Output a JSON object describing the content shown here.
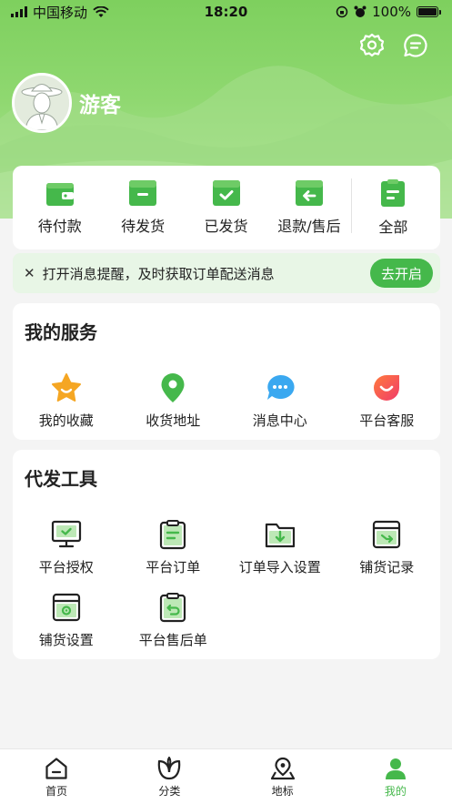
{
  "status_bar": {
    "carrier": "中国移动",
    "time": "18:20",
    "battery": "100%"
  },
  "header": {
    "settings_icon": "gear-icon",
    "message_icon": "chat-icon"
  },
  "profile": {
    "username": "游客"
  },
  "orders": [
    {
      "label": "待付款",
      "icon": "wallet-icon"
    },
    {
      "label": "待发货",
      "icon": "box-icon"
    },
    {
      "label": "已发货",
      "icon": "box-check-icon"
    },
    {
      "label": "退款/售后",
      "icon": "return-box-icon"
    },
    {
      "label": "全部",
      "icon": "clipboard-icon"
    }
  ],
  "notice": {
    "text": "打开消息提醒，及时获取订单配送消息",
    "button": "去开启"
  },
  "services": {
    "title": "我的服务",
    "items": [
      {
        "label": "我的收藏",
        "icon": "star-icon"
      },
      {
        "label": "收货地址",
        "icon": "location-pin-icon"
      },
      {
        "label": "消息中心",
        "icon": "message-bubble-icon"
      },
      {
        "label": "平台客服",
        "icon": "customer-service-icon"
      }
    ]
  },
  "tools": {
    "title": "代发工具",
    "items": [
      {
        "label": "平台授权",
        "icon": "monitor-check-icon"
      },
      {
        "label": "平台订单",
        "icon": "clipboard-list-icon"
      },
      {
        "label": "订单导入设置",
        "icon": "folder-import-icon"
      },
      {
        "label": "铺货记录",
        "icon": "box-arrow-icon"
      },
      {
        "label": "铺货设置",
        "icon": "box-settings-icon"
      },
      {
        "label": "平台售后单",
        "icon": "clipboard-return-icon"
      }
    ]
  },
  "tabbar": [
    {
      "label": "首页",
      "icon": "home-icon"
    },
    {
      "label": "分类",
      "icon": "leaf-icon"
    },
    {
      "label": "地标",
      "icon": "landmark-pin-icon"
    },
    {
      "label": "我的",
      "icon": "user-icon"
    }
  ],
  "colors": {
    "brand_green": "#45b84b",
    "header_green": "#7ed05e",
    "notice_bg": "#e8f6e6"
  }
}
